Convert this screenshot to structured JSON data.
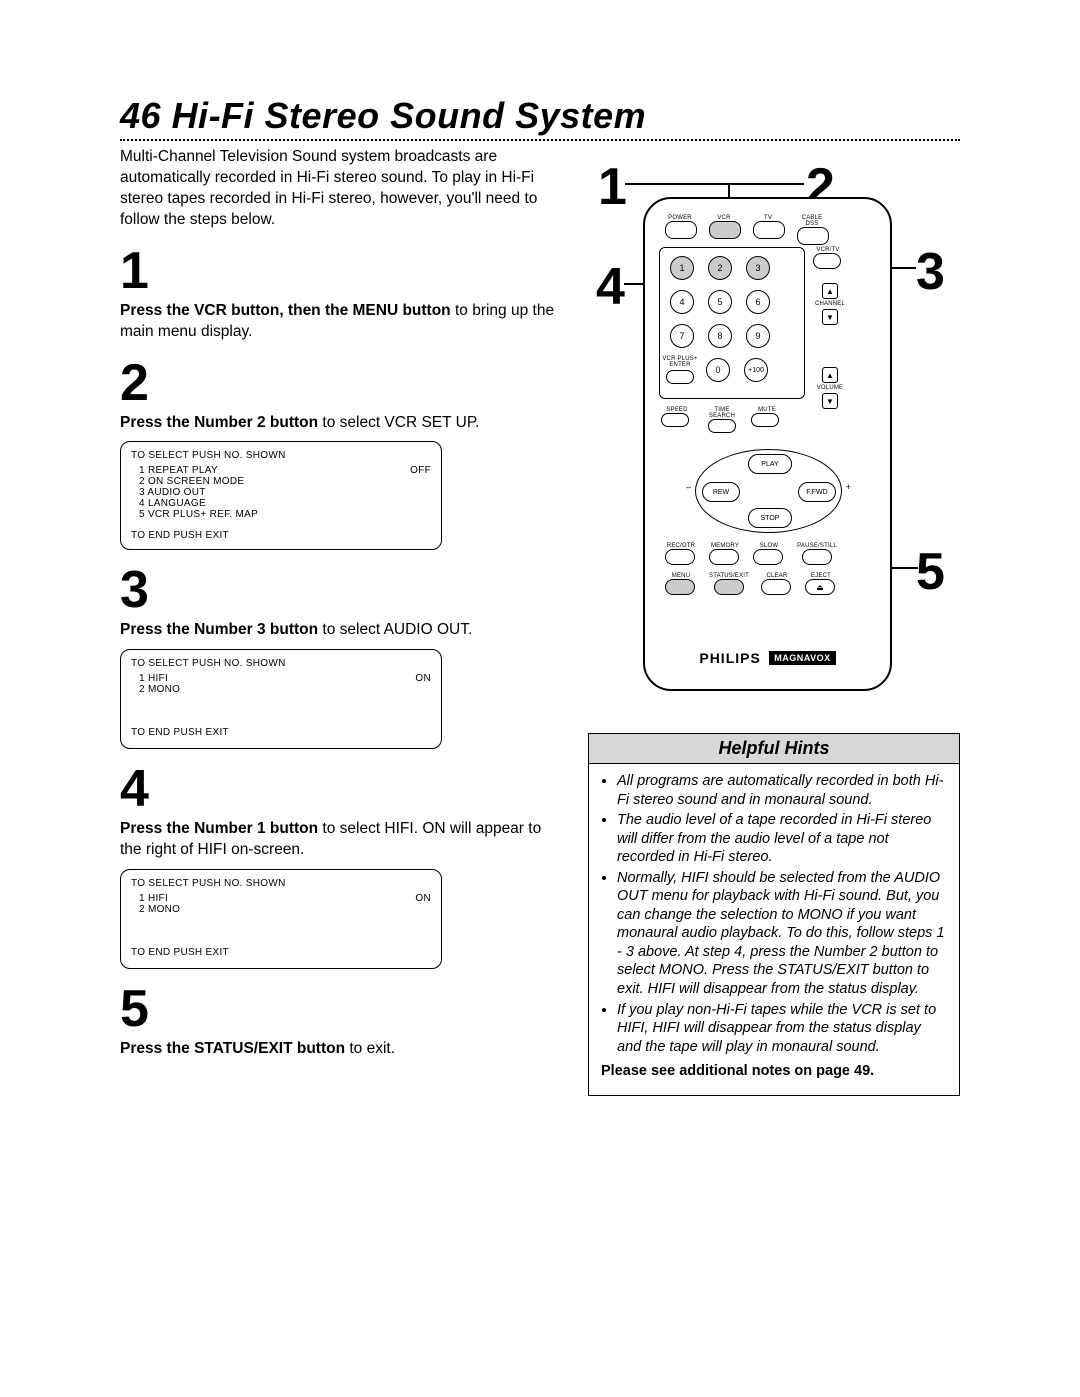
{
  "page_number": "46",
  "title": "Hi-Fi Stereo Sound System",
  "intro": "Multi-Channel Television Sound system broadcasts are automatically recorded in Hi-Fi stereo sound. To play in Hi-Fi stereo tapes recorded in Hi-Fi stereo, however, you'll need to follow the steps below.",
  "steps": {
    "s1": {
      "num": "1",
      "bold": "Press the VCR button, then the MENU button",
      "rest": " to bring up the main menu display."
    },
    "s2": {
      "num": "2",
      "bold": "Press the Number 2 button",
      "rest": " to select VCR SET UP."
    },
    "s3": {
      "num": "3",
      "bold": "Press the Number 3 button",
      "rest": " to select AUDIO OUT."
    },
    "s4": {
      "num": "4",
      "bold": "Press the Number 1 button",
      "rest": " to select HIFI. ON will appear to the right of HIFI on-screen."
    },
    "s5": {
      "num": "5",
      "bold": "Press the STATUS/EXIT button",
      "rest": " to exit."
    }
  },
  "menu1": {
    "header": "TO SELECT PUSH NO. SHOWN",
    "items": [
      {
        "label": "1 REPEAT PLAY",
        "val": "OFF"
      },
      {
        "label": "2 ON SCREEN MODE",
        "val": ""
      },
      {
        "label": "3 AUDIO OUT",
        "val": ""
      },
      {
        "label": "4 LANGUAGE",
        "val": ""
      },
      {
        "label": "5 VCR PLUS+ REF. MAP",
        "val": ""
      }
    ],
    "footer": "TO END PUSH EXIT"
  },
  "menu2": {
    "header": "TO SELECT PUSH NO. SHOWN",
    "items": [
      {
        "label": "1 HIFI",
        "val": "ON"
      },
      {
        "label": "2 MONO",
        "val": ""
      }
    ],
    "footer": "TO END PUSH EXIT"
  },
  "menu3": {
    "header": "TO SELECT PUSH NO. SHOWN",
    "items": [
      {
        "label": "1 HIFI",
        "val": "ON"
      },
      {
        "label": "2 MONO",
        "val": ""
      }
    ],
    "footer": "TO END PUSH EXIT"
  },
  "callouts": {
    "c1": "1",
    "c2": "2",
    "c3": "3",
    "c4": "4",
    "c5": "5"
  },
  "remote": {
    "row1": {
      "a": "POWER",
      "b": "VCR",
      "c": "TV",
      "d": "CABLE DSS"
    },
    "row2": {
      "a": "1",
      "b": "2",
      "c": "3",
      "d": "VCR/TV"
    },
    "row3": {
      "a": "4",
      "b": "5",
      "c": "6"
    },
    "row4": {
      "a": "7",
      "b": "8",
      "c": "9"
    },
    "row5": {
      "a": "0",
      "b": "+100"
    },
    "vcrplus": "VCR PLUS+ ENTER",
    "channel": "CHANNEL",
    "bottomRow": {
      "a": "SPEED",
      "b": "TIME SEARCH",
      "c": "MUTE"
    },
    "volume": "VOLUME",
    "dpad": {
      "play": "PLAY",
      "rew": "REW",
      "ffwd": "F.FWD",
      "stop": "STOP",
      "minus": "–",
      "plus": "+"
    },
    "row6": {
      "a": "REC/OTR",
      "b": "MEMORY",
      "c": "SLOW",
      "d": "PAUSE/STILL"
    },
    "row7": {
      "a": "MENU",
      "b": "STATUS/EXIT",
      "c": "CLEAR",
      "d": "EJECT"
    },
    "brand1": "PHILIPS",
    "brand2": "MAGNAVOX"
  },
  "hints": {
    "header": "Helpful Hints",
    "items": [
      "All programs are automatically recorded in both Hi-Fi stereo sound and in monaural sound.",
      "The audio level of a tape recorded in Hi-Fi stereo will differ from the audio level of a tape not recorded in Hi-Fi stereo.",
      "Normally, HIFI should be selected from the AUDIO OUT menu for playback with Hi-Fi sound. But, you can change the selection to MONO if you want monaural audio playback. To do this, follow steps 1 - 3 above. At step 4, press the Number 2 button to select MONO. Press the STATUS/EXIT button to exit. HIFI will disappear from the status display.",
      "If you play non-Hi-Fi tapes while the VCR is set to HIFI, HIFI will disappear from the status display and the tape will play in monaural sound."
    ],
    "note": "Please see additional notes on page 49."
  }
}
